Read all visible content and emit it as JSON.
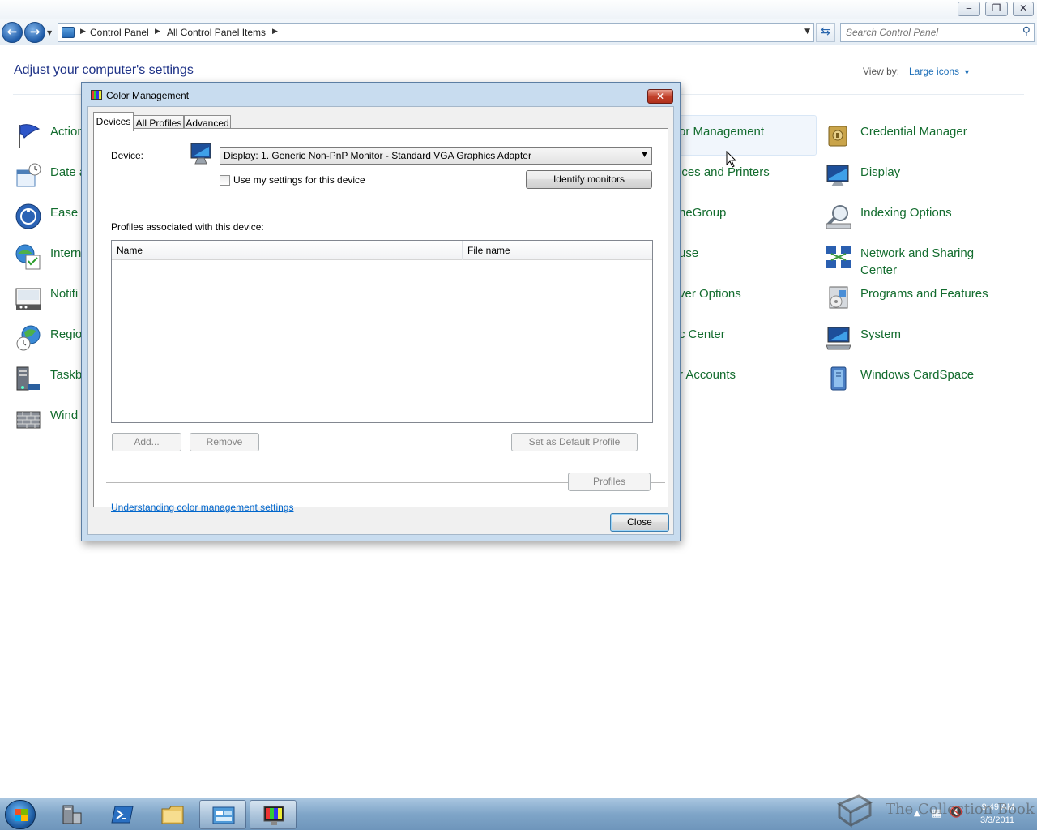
{
  "window": {
    "caption_min": "‒",
    "caption_max": "❐",
    "caption_close": "✕"
  },
  "nav": {
    "breadcrumbs": [
      "Control Panel",
      "All Control Panel Items"
    ],
    "search_placeholder": "Search Control Panel"
  },
  "control_panel": {
    "heading": "Adjust your computer's settings",
    "view_by_label": "View by:",
    "view_by_value": "Large icons",
    "items_col1": [
      "Action",
      "Date a",
      "Ease o",
      "Intern",
      "Notifi",
      "Regio",
      "Taskb",
      "Wind"
    ],
    "items_col3": [
      "or Management",
      "ices and Printers",
      "neGroup",
      "use",
      "ver Options",
      "c Center",
      "r Accounts"
    ],
    "items_col4": [
      {
        "label": "Credential Manager",
        "icon": "credential-manager-icon"
      },
      {
        "label": "Display",
        "icon": "display-icon"
      },
      {
        "label": "Indexing Options",
        "icon": "indexing-options-icon"
      },
      {
        "label": "Network and Sharing Center",
        "line1": "Network and Sharing",
        "line2": "Center",
        "icon": "network-sharing-icon"
      },
      {
        "label": "Programs and Features",
        "icon": "programs-features-icon"
      },
      {
        "label": "System",
        "icon": "system-icon"
      },
      {
        "label": "Windows CardSpace",
        "icon": "cardspace-icon"
      }
    ]
  },
  "dialog": {
    "title": "Color Management",
    "tabs": [
      "Devices",
      "All Profiles",
      "Advanced"
    ],
    "active_tab": "Devices",
    "device_label": "Device:",
    "device_value": "Display: 1. Generic Non-PnP Monitor - Standard VGA Graphics Adapter",
    "use_my_settings_label": "Use my settings for this device",
    "use_my_settings_checked": false,
    "identify_monitors_label": "Identify monitors",
    "profiles_label": "Profiles associated with this device:",
    "columns": [
      "Name",
      "File name"
    ],
    "rows": [],
    "add_label": "Add...",
    "remove_label": "Remove",
    "set_default_label": "Set as Default Profile",
    "help_link": "Understanding color management settings",
    "profiles_button": "Profiles",
    "close_button": "Close"
  },
  "taskbar": {
    "clock_time": "9:49 AM",
    "clock_date": "3/3/2011",
    "watermark": "The Collection Book"
  }
}
